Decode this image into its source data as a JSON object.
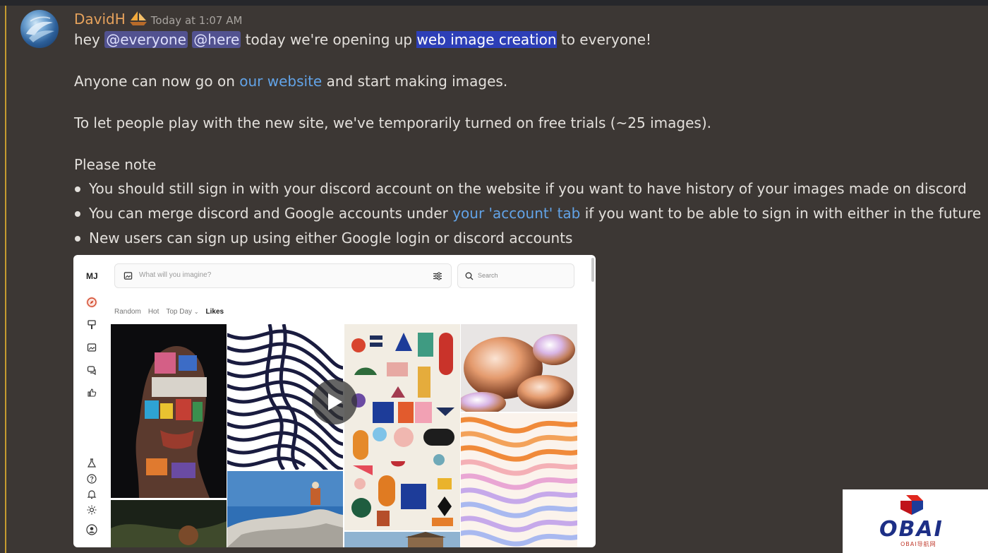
{
  "message": {
    "author": "DavidH",
    "author_badge": "sailboat-emoji",
    "timestamp": "Today at 1:07 AM",
    "line1": {
      "pre": "hey ",
      "mention_everyone": "@everyone",
      "mention_here": "@here",
      "mid": " today we're opening up ",
      "selected": "web image creation",
      "post": " to everyone!"
    },
    "line2": {
      "pre": "Anyone can now go on ",
      "link": "our website",
      "post": " and start making images."
    },
    "line3": "To let people play with the new site, we've temporarily turned on free trials (~25 images).",
    "line4": "Please note",
    "bullets": [
      {
        "text": "You should still sign in with your discord account on the website if you want to have history of your images made on discord"
      },
      {
        "pre": "You can merge discord and Google accounts under ",
        "link": "your 'account' tab",
        "post": " if you want to be able to sign in with either in the future"
      },
      {
        "text": "New users can sign up using either Google login or discord accounts"
      }
    ]
  },
  "embed": {
    "logo": "MJ",
    "imagine_placeholder": "What will you imagine?",
    "search_placeholder": "Search",
    "tabs": [
      "Random",
      "Hot",
      "Top Day",
      "Likes"
    ],
    "active_tab": "Likes",
    "sidebar_icons": [
      "compass-icon",
      "brush-icon",
      "image-icon",
      "chat-icon",
      "thumbs-up-icon",
      "flask-icon",
      "help-icon",
      "bell-icon",
      "sun-icon",
      "user-icon"
    ]
  },
  "watermark": {
    "text": "OBAI",
    "subtext": "OBAI导航网"
  },
  "colors": {
    "background": "#3c3734",
    "username": "#e6a25c",
    "mention_bg": "#525290",
    "selection_bg": "#2d3fb7",
    "link": "#62a3e7",
    "highlight_bar": "#c69b2f"
  }
}
